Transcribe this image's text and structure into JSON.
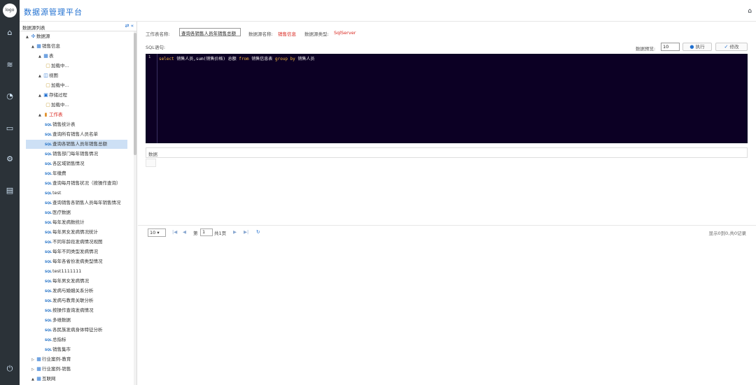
{
  "app": {
    "title": "数据源管理平台",
    "logo_text": "logo"
  },
  "rail": {
    "icons": [
      "home-icon",
      "database-icon",
      "dashboard-icon",
      "monitor-icon",
      "settings-icon",
      "pdf-icon",
      "power-icon"
    ]
  },
  "tree": {
    "header": "数据源列表",
    "nodes": [
      {
        "label": "数据源",
        "level": 0,
        "arrow": "▲",
        "icon": "root"
      },
      {
        "label": "销售信息",
        "level": 1,
        "arrow": "▲",
        "icon": "db"
      },
      {
        "label": "表",
        "level": 2,
        "arrow": "▲",
        "icon": "table"
      },
      {
        "label": "加载中...",
        "level": 3,
        "arrow": "",
        "icon": "doc"
      },
      {
        "label": "视图",
        "level": 2,
        "arrow": "▲",
        "icon": "view"
      },
      {
        "label": "加载中...",
        "level": 3,
        "arrow": "",
        "icon": "doc"
      },
      {
        "label": "存储过程",
        "level": 2,
        "arrow": "▲",
        "icon": "proc"
      },
      {
        "label": "加载中...",
        "level": 3,
        "arrow": "",
        "icon": "doc"
      },
      {
        "label": "工作表",
        "level": 2,
        "arrow": "▲",
        "icon": "chart",
        "red": true
      },
      {
        "label": "销售统计表",
        "level": 3,
        "icon": "sql"
      },
      {
        "label": "查询所有销售人员名单",
        "level": 3,
        "icon": "sql"
      },
      {
        "label": "查询各销售人员年销售总额",
        "level": 3,
        "icon": "sql",
        "selected": true
      },
      {
        "label": "销售部门每年销售情况",
        "level": 3,
        "icon": "sql"
      },
      {
        "label": "各区域销售情况",
        "level": 3,
        "icon": "sql"
      },
      {
        "label": "年缴费",
        "level": 3,
        "icon": "sql"
      },
      {
        "label": "查询每月销售状况（按操作查询）",
        "level": 3,
        "icon": "sql"
      },
      {
        "label": "test",
        "level": 3,
        "icon": "sql"
      },
      {
        "label": "查询销售各销售人员每年销售情况",
        "level": 3,
        "icon": "sql"
      },
      {
        "label": "医疗数据",
        "level": 3,
        "icon": "sql"
      },
      {
        "label": "每年发病数统计",
        "level": 3,
        "icon": "sql"
      },
      {
        "label": "每年男女发病情况统计",
        "level": 3,
        "icon": "sql"
      },
      {
        "label": "不同年龄段发病情况视图",
        "level": 3,
        "icon": "sql"
      },
      {
        "label": "每年不同类型发病情况",
        "level": 3,
        "icon": "sql"
      },
      {
        "label": "每年各省份发病类型情况",
        "level": 3,
        "icon": "sql"
      },
      {
        "label": "test1111111",
        "level": 3,
        "icon": "sql"
      },
      {
        "label": "每年男女发病情况",
        "level": 3,
        "icon": "sql"
      },
      {
        "label": "发病与婚姻关系分析",
        "level": 3,
        "icon": "sql"
      },
      {
        "label": "发病与教育关联分析",
        "level": 3,
        "icon": "sql"
      },
      {
        "label": "按操作查询发病情况",
        "level": 3,
        "icon": "sql"
      },
      {
        "label": "多维数据",
        "level": 3,
        "icon": "sql"
      },
      {
        "label": "各民族发病身体特征分析",
        "level": 3,
        "icon": "sql"
      },
      {
        "label": "总指标",
        "level": 3,
        "icon": "sql"
      },
      {
        "label": "销售集市",
        "level": 3,
        "icon": "sql"
      },
      {
        "label": "行业案例-教育",
        "level": 1,
        "arrow": "▷",
        "icon": "db"
      },
      {
        "label": "行业案例-销售",
        "level": 1,
        "arrow": "▷",
        "icon": "db"
      },
      {
        "label": "互联网",
        "level": 1,
        "arrow": "▲",
        "icon": "db"
      }
    ]
  },
  "form": {
    "sheet_name_label": "工作表名称:",
    "sheet_name_value": "查询各销售人员年销售总额",
    "source_name_label": "数据源名称:",
    "source_name_value": "销售信息",
    "source_type_label": "数据源类型:",
    "source_type_value": "SqlServer",
    "sql_label": "SQL语句:",
    "preview_label": "数据预览:",
    "preview_value": "10",
    "execute_label": "执行",
    "modify_label": "修改"
  },
  "editor": {
    "line_number": "1",
    "tokens": [
      {
        "t": "select",
        "kw": true
      },
      {
        "t": " 销售人员,sum(销售价格) 总额 ",
        "kw": false
      },
      {
        "t": "from",
        "kw": true
      },
      {
        "t": " 销售信息表 ",
        "kw": false
      },
      {
        "t": "group by",
        "kw": true
      },
      {
        "t": " 销售人员",
        "kw": false
      }
    ]
  },
  "data_section": {
    "label": "数据"
  },
  "pager": {
    "page_size": "10",
    "page_prefix": "第",
    "page_value": "1",
    "page_suffix": "共1页",
    "info": "显示0到0,共0记录"
  },
  "colors": {
    "accent": "#1f6fd0",
    "rail": "#2b3238",
    "editor_bg": "#0c0024",
    "red": "#d9251d"
  }
}
